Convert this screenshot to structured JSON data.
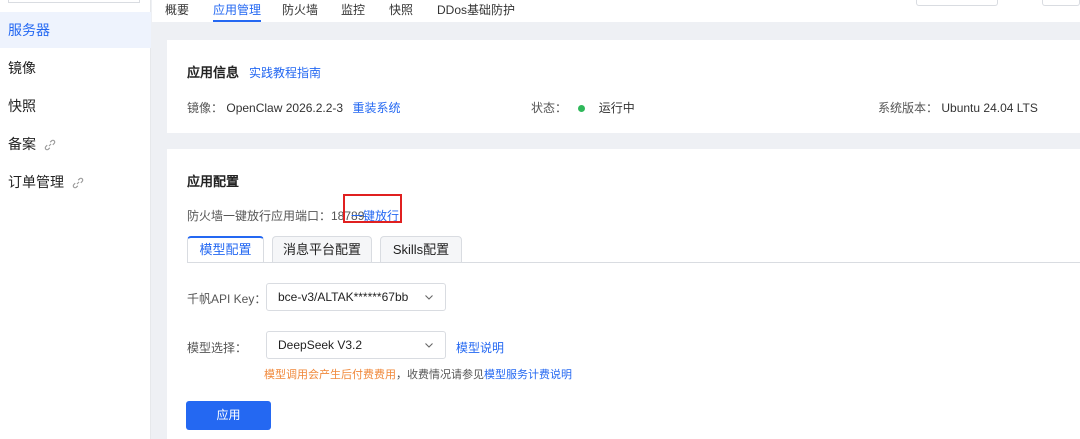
{
  "sidebar": {
    "items": [
      {
        "label": "服务器",
        "active": true
      },
      {
        "label": "镜像"
      },
      {
        "label": "快照"
      },
      {
        "label": "备案",
        "icon": "link-icon"
      },
      {
        "label": "订单管理",
        "icon": "link-icon"
      }
    ]
  },
  "top_tabs": [
    "概要",
    "应用管理",
    "防火墙",
    "监控",
    "快照",
    "DDos基础防护"
  ],
  "app_info": {
    "title": "应用信息",
    "guide_link": "实践教程指南",
    "image_label": "镜像：",
    "image_value": "OpenClaw 2026.2.2-3",
    "reinstall_link": "重装系统",
    "status_label": "状态：",
    "status_value": "运行中",
    "os_label": "系统版本：",
    "os_value": "Ubuntu 24.04 LTS"
  },
  "app_config": {
    "title": "应用配置",
    "firewall_text": "防火墙一键放行应用端口：18789",
    "one_click_link": "一键放行",
    "tabs": [
      "模型配置",
      "消息平台配置",
      "Skills配置"
    ],
    "api_key_label": "千帆API Key：",
    "api_key_value": "bce-v3/ALTAK******67bb",
    "model_label": "模型选择：",
    "model_value": "DeepSeek V3.2",
    "model_help_link": "模型说明",
    "billing_warn": "模型调用会产生后付费费用",
    "billing_text": "，收费情况请参见",
    "billing_link": "模型服务计费说明",
    "apply_button": "应用"
  },
  "colors": {
    "accent": "#2468f2",
    "highlight": "#e02020",
    "status": "#2fb85a",
    "warning": "#f0883a"
  }
}
